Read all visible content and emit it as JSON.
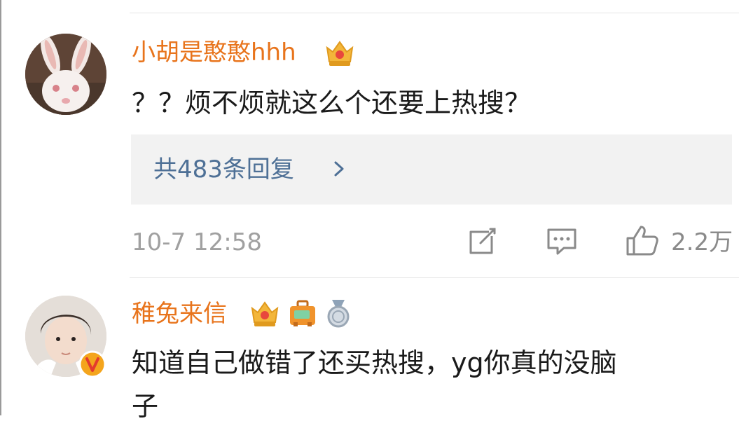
{
  "comments": [
    {
      "username": "小胡是憨憨hhh",
      "avatar": "rabbit-photo-avatar",
      "badges": [
        "crown-vip-badge"
      ],
      "text": "？？烦不烦就这么个还要上热搜？",
      "replies_label": "共483条回复",
      "timestamp": "10-7 12:58",
      "likes": "2.2万",
      "actions": [
        "share-icon",
        "comment-icon",
        "like-icon"
      ]
    },
    {
      "username": "稚兔来信",
      "avatar": "person-photo-avatar",
      "verified": "verified-v-badge",
      "badges": [
        "crown-vip-badge",
        "suitcase-badge",
        "medal-badge"
      ],
      "text_line1": "知道自己做错了还买热搜，yg你真的没脑",
      "text_line2": "子"
    }
  ],
  "colors": {
    "username": "#e8741c",
    "reply_link": "#4e7096",
    "reply_bg": "#f2f2f2",
    "meta": "#a0a0a0"
  }
}
